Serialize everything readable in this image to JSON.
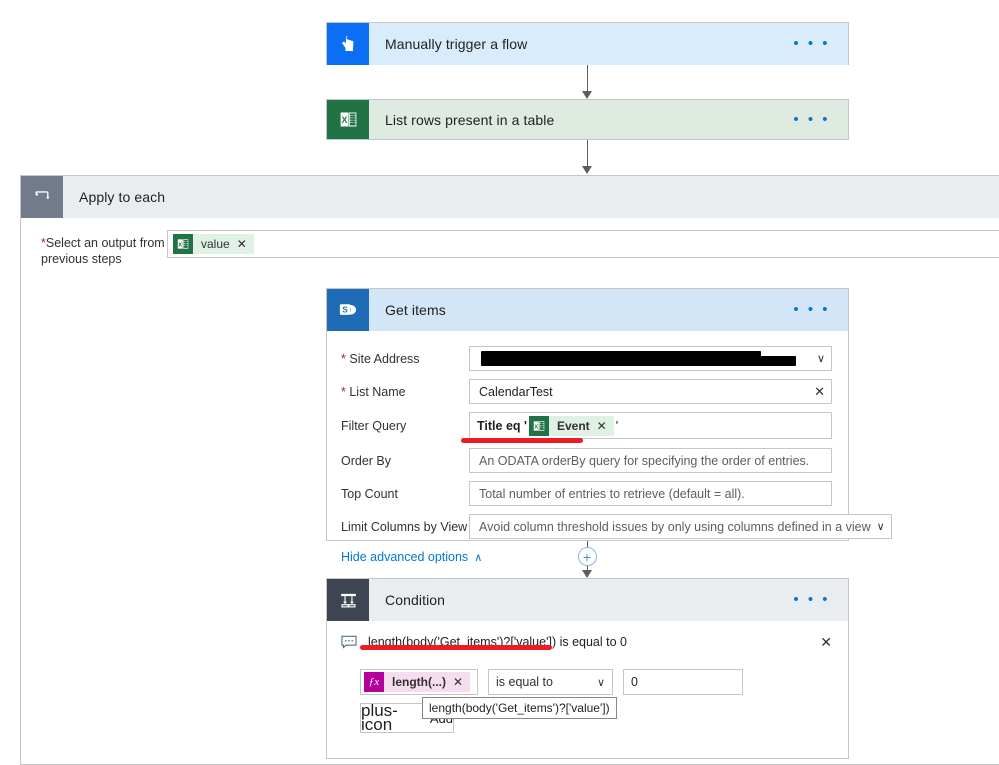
{
  "flow": {
    "trigger": {
      "title": "Manually trigger a flow",
      "icon": "manual-trigger-hand-icon",
      "menu": "• • •"
    },
    "list_rows": {
      "title": "List rows present in a table",
      "icon": "excel-icon",
      "menu": "• • •"
    },
    "apply_to_each": {
      "title": "Apply to each",
      "icon": "loop-icon",
      "select_output": {
        "label_required": "*",
        "label": "Select an output from previous steps",
        "token": {
          "text": "value",
          "remove": "✕",
          "icon": "excel-icon"
        }
      }
    },
    "get_items": {
      "title": "Get items",
      "icon": "sharepoint-icon",
      "menu": "• • •",
      "fields": [
        {
          "label": "Site Address",
          "required": true,
          "type": "redacted-dropdown",
          "value": "",
          "chevron": "∨"
        },
        {
          "label": "List Name",
          "required": true,
          "type": "text-clear",
          "value": "CalendarTest",
          "clear": "✕"
        },
        {
          "label": "Filter Query",
          "required": false,
          "type": "token-expression",
          "prefix": "Title eq '",
          "token": {
            "text": "Event",
            "remove": "✕",
            "icon": "excel-icon"
          },
          "suffix": "'"
        },
        {
          "label": "Order By",
          "required": false,
          "type": "placeholder",
          "placeholder": "An ODATA orderBy query for specifying the order of entries."
        },
        {
          "label": "Top Count",
          "required": false,
          "type": "placeholder",
          "placeholder": "Total number of entries to retrieve (default = all)."
        },
        {
          "label": "Limit Columns by View",
          "required": false,
          "type": "placeholder-dropdown",
          "placeholder": "Avoid column threshold issues by only using columns defined in a view",
          "chevron": "∨"
        }
      ],
      "advanced_link": "Hide advanced options",
      "advanced_chevron": "∧"
    },
    "add_step_node": "+",
    "condition": {
      "title": "Condition",
      "icon": "condition-branch-icon",
      "menu": "• • •",
      "expression_summary": "length(body('Get_items')?['value']) is equal to 0",
      "comment_icon": "comment-icon",
      "close": "✕",
      "operand": {
        "text": "length(...)",
        "remove": "✕",
        "icon": "fx-icon",
        "fx_label": "ƒx"
      },
      "operator": {
        "value": "is equal to",
        "chevron": "∨"
      },
      "value": "0",
      "add_button": {
        "label": "Add",
        "icon": "plus-icon"
      },
      "tooltip": "length(body('Get_items')?['value'])"
    }
  },
  "annotations": {
    "highlight_color": "#ec1c24"
  }
}
